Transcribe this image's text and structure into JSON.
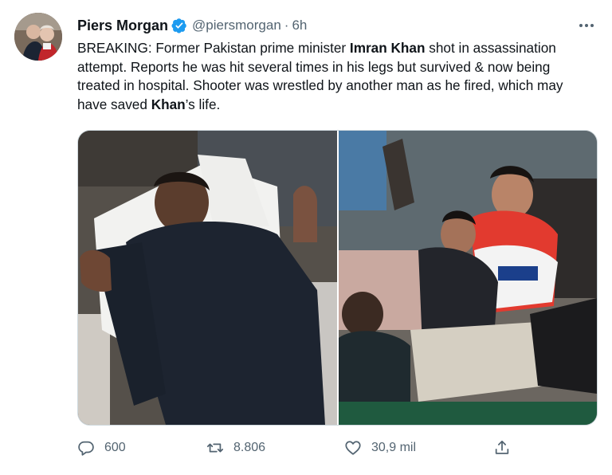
{
  "tweet": {
    "author_name": "Piers Morgan",
    "handle": "@piersmorgan",
    "separator": "·",
    "time": "6h",
    "text_segments": [
      {
        "t": "BREAKING: Former Pakistan prime minister ",
        "bold": false
      },
      {
        "t": "Imran Khan",
        "bold": true
      },
      {
        "t": " shot in assassination attempt. Reports he was hit several times in his legs but survived & now being treated in hospital. Shooter was wrestled by another man as he fired, which may have saved ",
        "bold": false
      },
      {
        "t": "Khan",
        "bold": true
      },
      {
        "t": "’s life.",
        "bold": false
      }
    ]
  },
  "actions": {
    "replies": "600",
    "retweets": "8.806",
    "likes": "30,9 mil"
  },
  "icons": {
    "verified": "verified-badge-icon",
    "more": "more-options-icon",
    "reply": "reply-icon",
    "retweet": "retweet-icon",
    "like": "heart-icon",
    "share": "share-icon"
  },
  "colors": {
    "verified_blue": "#1d9bf0",
    "secondary_text": "#536471",
    "primary_text": "#0f1419",
    "border": "#cfd9de"
  }
}
